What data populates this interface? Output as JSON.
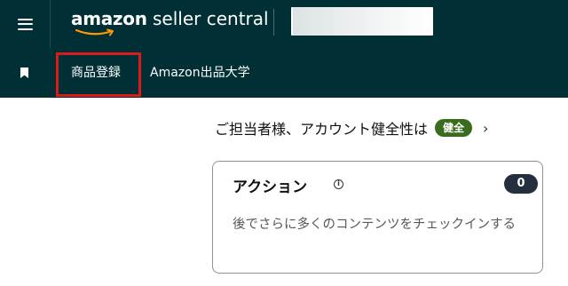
{
  "header": {
    "logo": {
      "brand": "amazon",
      "product": "seller central"
    },
    "menu_icon": "hamburger-menu-icon",
    "bg_color": "#002f36"
  },
  "nav": {
    "bookmark_icon": "bookmark-icon",
    "items": [
      {
        "label": "商品登録",
        "highlighted": true
      },
      {
        "label": "Amazon出品大学"
      }
    ],
    "highlight_color": "#dd1a1a"
  },
  "account_health": {
    "text": "ご担当者様、アカウント健全性は",
    "badge": "健全",
    "badge_color": "#3a6c1e",
    "chevron_icon": "chevron-right-icon"
  },
  "actions_card": {
    "title": "アクション",
    "info_icon": "info-icon",
    "count": "0",
    "body": "後でさらに多くのコンテンツをチェックインする"
  }
}
